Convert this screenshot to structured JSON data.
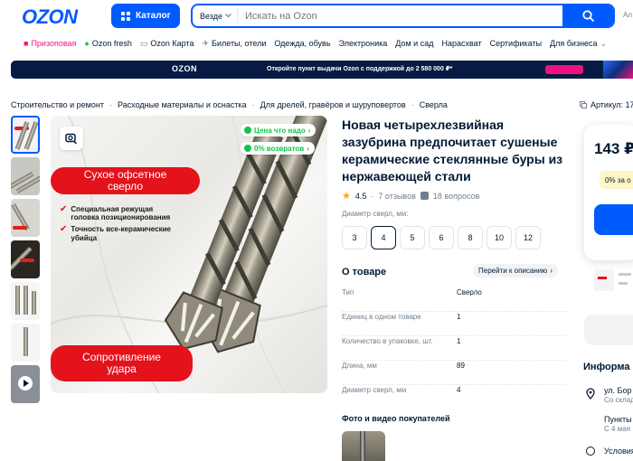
{
  "header": {
    "logo": "OZON",
    "catalog_label": "Каталог",
    "search_scope": "Везде",
    "search_placeholder": "Искать на Ozon",
    "right_clip": "Ал"
  },
  "nav": [
    {
      "label": "Призоповая",
      "icon": "gift-icon",
      "accent": "#f1117e"
    },
    {
      "label": "Ozon fresh",
      "icon": "leaf-icon"
    },
    {
      "label": "Ozon Карта",
      "icon": "card-icon"
    },
    {
      "label": "Билеты, отели",
      "icon": "plane-icon"
    },
    {
      "label": "Одежда, обувь"
    },
    {
      "label": "Электроника"
    },
    {
      "label": "Дом и сад"
    },
    {
      "label": "Нарасхват"
    },
    {
      "label": "Сертификаты"
    },
    {
      "label": "Для бизнеса"
    }
  ],
  "banner": {
    "logo": "OZON",
    "text": "Откройте пункт выдачи Ozon с поддержкой до 2 580 000 ₽*"
  },
  "breadcrumbs": [
    "Строительство и ремонт",
    "Расходные материалы и оснастка",
    "Для дрелей, гравёров и шуруповертов",
    "Сверла"
  ],
  "article_label": "Артикул: 17",
  "image": {
    "badge_price": "Цена что надо",
    "badge_returns": "0% возвратов",
    "pill_top": "Сухое офсетное сверло",
    "features": [
      "Специальная режущая головка позиционирования",
      "Точность все-керамические убийца"
    ],
    "pill_bottom": "Сопротивление удара"
  },
  "product": {
    "title": "Новая четырехлезвийная зазубрина предпочитает сушеные керамические стеклянные буры из нержавеющей стали",
    "rating": "4.5",
    "reviews": "7 отзывов",
    "questions": "18 вопросов",
    "diameter_label": "Диаметр сверл, мм:",
    "diameters": [
      "3",
      "4",
      "5",
      "6",
      "8",
      "10",
      "12"
    ],
    "selected_diameter": "4"
  },
  "about": {
    "title": "О товаре",
    "link": "Перейти к описанию",
    "specs": [
      {
        "k": "Тип",
        "v": "Сверло"
      },
      {
        "k": "Единиц в одном товаре",
        "v": "1"
      },
      {
        "k": "Количество в упаковке, шт.",
        "v": "1"
      },
      {
        "k": "Длина, мм",
        "v": "89"
      },
      {
        "k": "Диаметр сверл, мм",
        "v": "4"
      }
    ]
  },
  "photos_title": "Фото и видео покупателей",
  "right": {
    "price": "143 ₽",
    "bonus": "0% за о",
    "info_title": "Информа",
    "address": "ул. Бор",
    "address_sub": "Со склад",
    "points": "Пункты",
    "points_sub": "С 4 мая",
    "conditions": "Условия"
  }
}
